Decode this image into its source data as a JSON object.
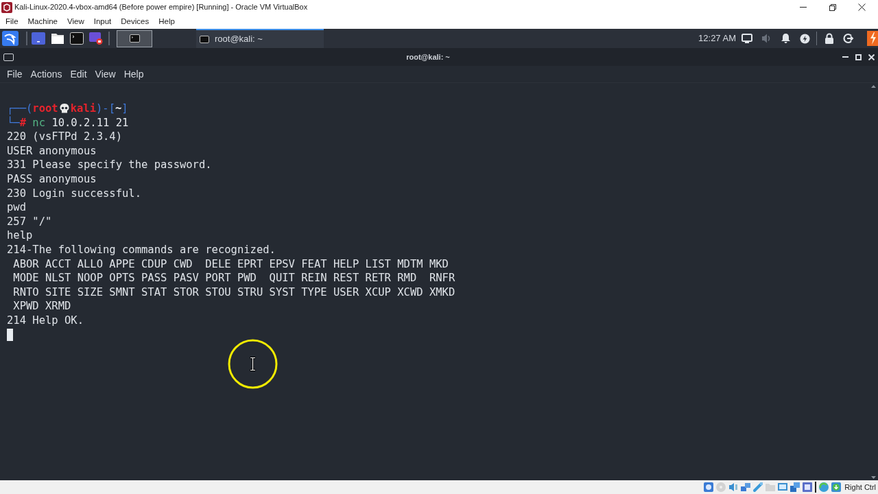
{
  "window": {
    "title": "Kali-Linux-2020.4-vbox-amd64 (Before power empire) [Running] - Oracle VM VirtualBox"
  },
  "menu_bar": [
    "File",
    "Machine",
    "View",
    "Input",
    "Devices",
    "Help"
  ],
  "panel": {
    "workspaces": [
      {
        "selected": true
      }
    ],
    "tasks": [
      {
        "label": "root@kali: ~",
        "selected": true
      }
    ],
    "clock": "12:27 AM",
    "volume": {
      "muted": true
    }
  },
  "terminal": {
    "title": "root@kali: ~",
    "menu": [
      "File",
      "Actions",
      "Edit",
      "View",
      "Help"
    ],
    "prompt": {
      "open": "┌──(",
      "user": "root",
      "host": "kali",
      "separator": ")-[",
      "cwd": "~",
      "close": "]",
      "corner": "└─",
      "symbol": "#",
      "command": "nc",
      "arguments": "10.0.2.11 21"
    },
    "output": [
      "220 (vsFTPd 2.3.4)",
      "USER anonymous",
      "331 Please specify the password.",
      "PASS anonymous",
      "230 Login successful.",
      "pwd",
      "257 \"/\"",
      "help",
      "214-The following commands are recognized.",
      " ABOR ACCT ALLO APPE CDUP CWD  DELE EPRT EPSV FEAT HELP LIST MDTM MKD",
      " MODE NLST NOOP OPTS PASS PASV PORT PWD  QUIT REIN REST RETR RMD  RNFR",
      " RNTO SITE SIZE SMNT STAT STOR STOU STRU SYST TYPE USER XCUP XCWD XMKD",
      " XPWD XRMD",
      "214 Help OK."
    ]
  },
  "status_bar": {
    "host_key": "Right Ctrl"
  }
}
